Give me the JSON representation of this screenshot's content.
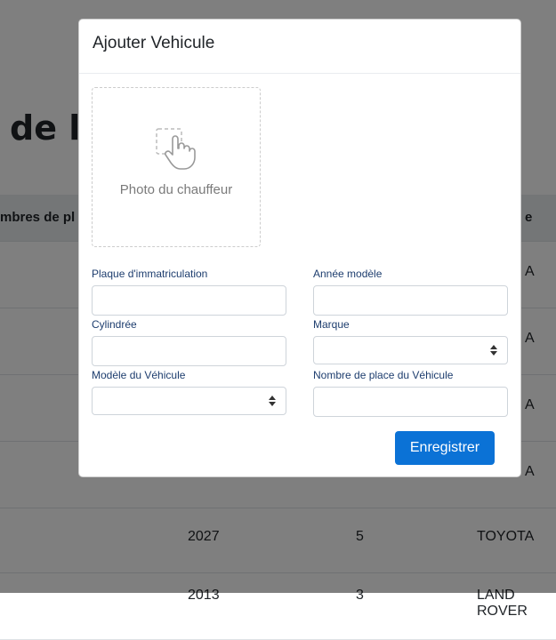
{
  "background": {
    "title": "de la",
    "headers": [
      "mbres de pl",
      "e"
    ],
    "rows": [
      {
        "year": "",
        "places": "",
        "brand": "A"
      },
      {
        "year": "",
        "places": "",
        "brand": "A"
      },
      {
        "year": "",
        "places": "",
        "brand": "A"
      },
      {
        "year": "",
        "places": "",
        "brand": "A"
      },
      {
        "year": "2027",
        "places": "5",
        "brand": "TOYOTA"
      },
      {
        "year": "2013",
        "places": "3",
        "brand": "LAND ROVER"
      }
    ]
  },
  "modal": {
    "title": "Ajouter Vehicule",
    "photo_label": "Photo du chauffeur",
    "fields": {
      "plaque": {
        "label": "Plaque d'immatriculation",
        "value": ""
      },
      "annee": {
        "label": "Année modèle",
        "value": ""
      },
      "cylindree": {
        "label": "Cylindrée",
        "value": ""
      },
      "marque": {
        "label": "Marque",
        "value": ""
      },
      "modele": {
        "label": "Modèle du Véhicule",
        "value": ""
      },
      "places": {
        "label": "Nombre de place du Véhicule",
        "value": ""
      }
    },
    "save_label": "Enregistrer"
  },
  "colors": {
    "accent": "#0b72d6",
    "label": "#1d3d6e"
  }
}
